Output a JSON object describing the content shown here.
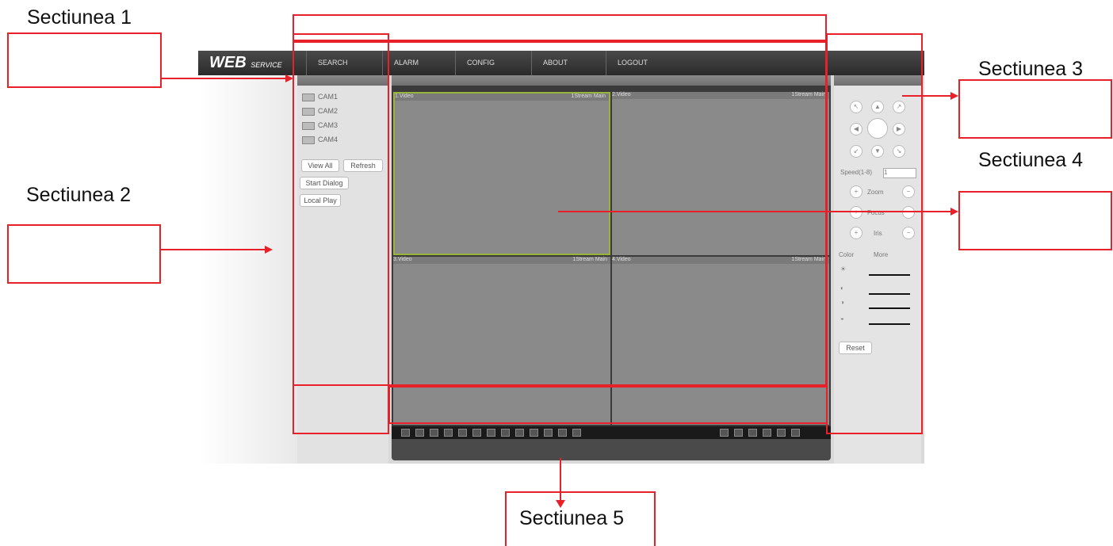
{
  "annotations": {
    "section1": "Sectiunea 1",
    "section2": "Sectiunea  2",
    "section3": "Sectiunea 3",
    "section4": "Sectiunea 4",
    "section5": "Sectiunea 5",
    "accent_color": "#e8202a"
  },
  "app": {
    "logo_main": "WEB",
    "logo_sub": "SERVICE"
  },
  "topmenu": {
    "items": [
      "SEARCH",
      "ALARM",
      "CONFIG",
      "ABOUT",
      "LOGOUT"
    ]
  },
  "left": {
    "cameras": [
      "CAM1",
      "CAM2",
      "CAM3",
      "CAM4"
    ],
    "view_all": "View All",
    "refresh": "Refresh",
    "start_dialog": "Start Dialog",
    "local_play": "Local Play"
  },
  "video": {
    "cells": [
      {
        "name": "1.Video",
        "status": "1Stream Main"
      },
      {
        "name": "2.Video",
        "status": "1Stream Main"
      },
      {
        "name": "3.Video",
        "status": "1Stream Main"
      },
      {
        "name": "4.Video",
        "status": "1Stream Main"
      }
    ]
  },
  "ptz": {
    "speed_label": "Speed(1-8)",
    "speed_value": "1",
    "zoom_label": "Zoom",
    "focus_label": "Focus",
    "iris_label": "Iris",
    "tabs": [
      "Color",
      "More"
    ],
    "reset": "Reset"
  }
}
